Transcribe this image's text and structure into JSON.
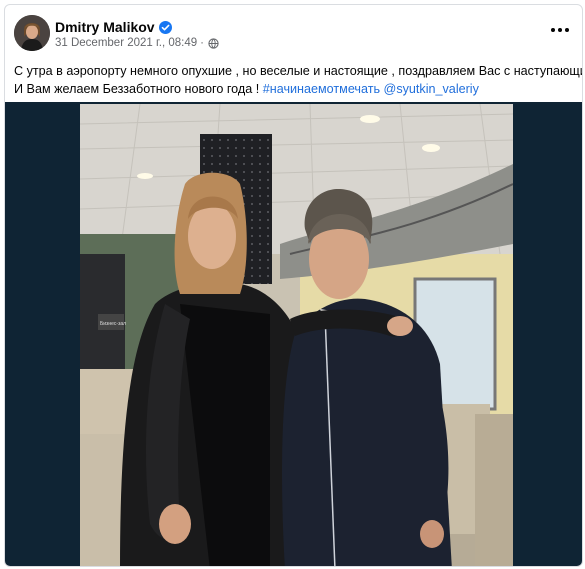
{
  "post": {
    "author": "Dmitry Malikov",
    "date": "31 December 2021 г., 08:49",
    "separator": "·",
    "icons": {
      "verified": "verified-badge-icon",
      "audience": "globe-icon",
      "more": "more-options-icon"
    },
    "caption": {
      "line1": "С утра в аэропорту немного опухшие , но веселые и настоящие , поздравляем Вас с наступающим !",
      "line2_text": "И Вам желаем Беззаботного нового года !",
      "hashtag": "#начинаемотмечать",
      "mention": "@syutkin_valeriy"
    },
    "photo": {
      "sign_text": "Бизнес-зал"
    }
  },
  "colors": {
    "link": "#216fdb",
    "verified": "#1877f2",
    "muted": "#65676b",
    "photo_background": "#0f2434"
  }
}
